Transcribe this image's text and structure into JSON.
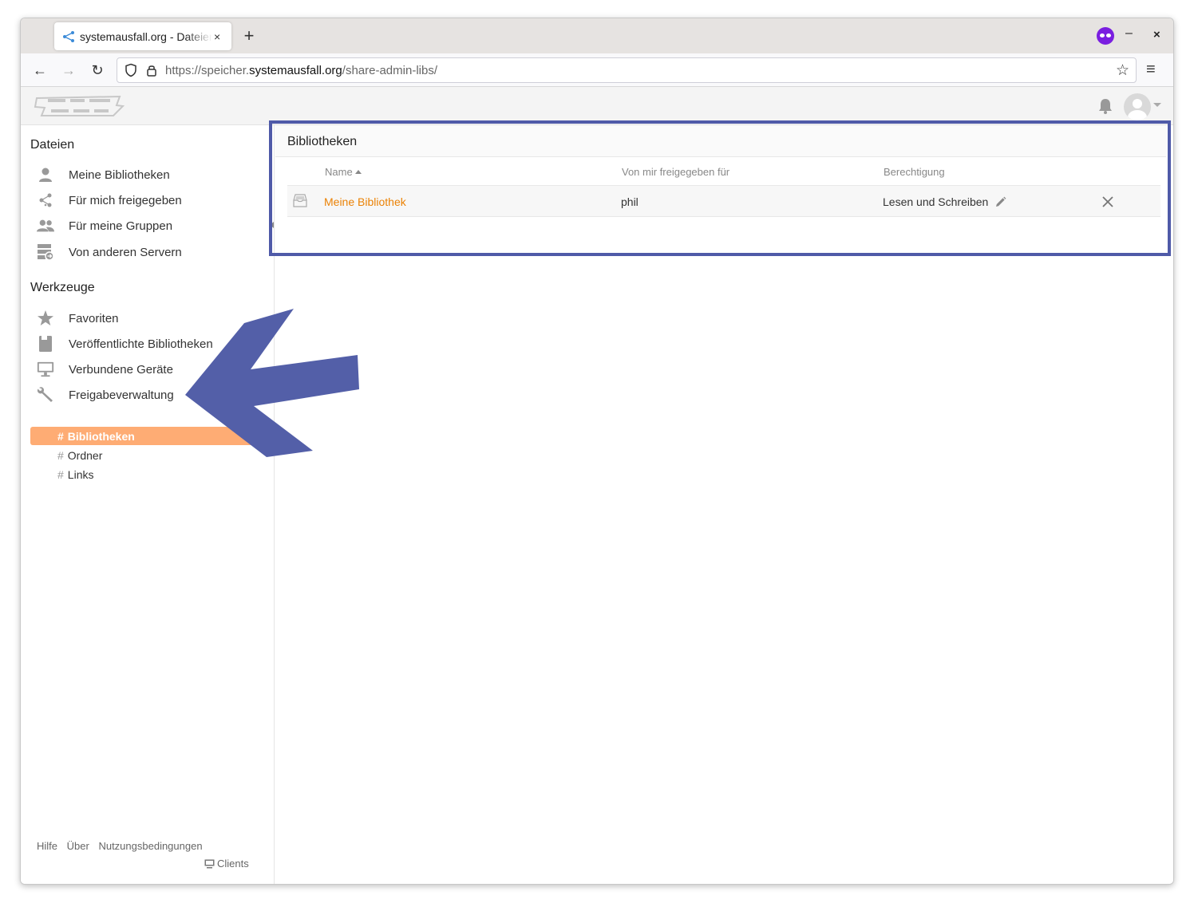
{
  "browser": {
    "tab_title": "systemausfall.org - Dateien",
    "tab_close": "×",
    "new_tab": "+",
    "minimize": "–",
    "close": "×",
    "url_prefix": "https://speicher.",
    "url_host": "systemausfall.org",
    "url_path": "/share-admin-libs/",
    "back": "←",
    "forward": "→",
    "reload": "↻",
    "bookmark": "☆",
    "menu": "≡"
  },
  "sidebar": {
    "files_heading": "Dateien",
    "files_items": [
      {
        "label": "Meine Bibliotheken",
        "icon": "user-icon"
      },
      {
        "label": "Für mich freigegeben",
        "icon": "share-icon"
      },
      {
        "label": "Für meine Gruppen",
        "icon": "group-icon"
      },
      {
        "label": "Von anderen Servern",
        "icon": "server-icon"
      }
    ],
    "tools_heading": "Werkzeuge",
    "tools_items": [
      {
        "label": "Favoriten",
        "icon": "star-icon"
      },
      {
        "label": "Veröffentlichte Bibliotheken",
        "icon": "book-icon"
      },
      {
        "label": "Verbundene Geräte",
        "icon": "monitor-icon"
      },
      {
        "label": "Freigabeverwaltung",
        "icon": "wrench-icon"
      }
    ],
    "sub_items": [
      {
        "label": "Bibliotheken",
        "active": true
      },
      {
        "label": "Ordner",
        "active": false
      },
      {
        "label": "Links",
        "active": false
      }
    ],
    "hash": "#",
    "footer": {
      "help": "Hilfe",
      "about": "Über",
      "terms": "Nutzungsbedingungen",
      "clients": "Clients"
    }
  },
  "main": {
    "title": "Bibliotheken",
    "columns": {
      "name": "Name",
      "shared_to": "Von mir freigegeben für",
      "permission": "Berechtigung"
    },
    "rows": [
      {
        "name": "Meine Bibliothek",
        "shared_to": "phil",
        "permission": "Lesen und Schreiben"
      }
    ]
  },
  "colors": {
    "accent": "#eb8205",
    "active_nav": "#feac74",
    "annotation": "#4f5aa8"
  }
}
